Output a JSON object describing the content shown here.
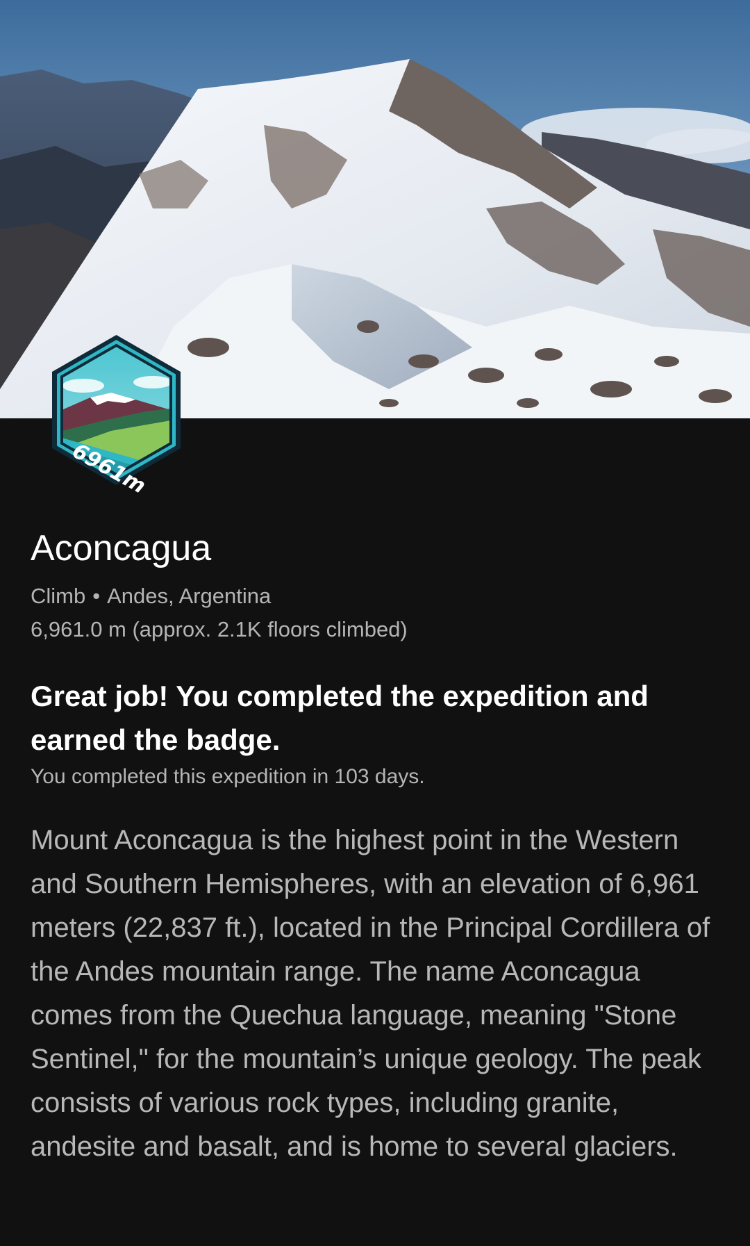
{
  "expedition": {
    "badge_label": "6961m",
    "title": "Aconcagua",
    "activity": "Climb",
    "separator": "•",
    "location": "Andes, Argentina",
    "distance_line": "6,961.0 m (approx. 2.1K floors climbed)",
    "congrats": "Great job! You completed the expedition and earned the badge.",
    "duration": "You completed this expedition in 103 days.",
    "description": "Mount Aconcagua is the highest point in the Western and Southern Hemispheres, with an elevation of 6,961 meters (22,837 ft.), located in the Principal Cordillera of the Andes mountain range. The name Aconcagua comes from the Quechua language, meaning \"Stone Sentinel,\" for the mountain’s unique geology. The peak consists of various rock types, including granite, andesite and basalt, and is home to several glaciers."
  },
  "colors": {
    "background": "#111111",
    "badge_teal": "#2fb7c6",
    "badge_green": "#7ac24d"
  }
}
